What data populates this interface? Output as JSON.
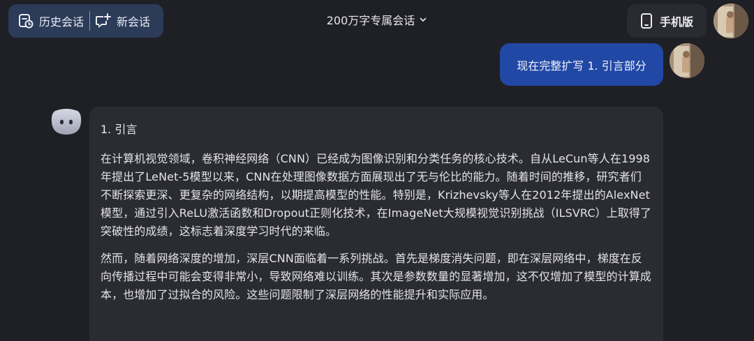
{
  "header": {
    "history_label": "历史会话",
    "new_chat_label": "新会话",
    "title": "200万字专属会话",
    "mobile_label": "手机版"
  },
  "icons": {
    "history": "history-clock-icon",
    "new_chat": "new-chat-icon",
    "dropdown": "chevron-down-icon",
    "mobile": "phone-icon",
    "bot": "bot-avatar-icon"
  },
  "colors": {
    "background": "#1f2025",
    "left_pill": "#2c3b58",
    "user_bubble": "#2248a6",
    "bot_card": "#2b2c33"
  },
  "messages": {
    "user_text": "现在完整扩写 1. 引言部分",
    "bot_heading": "1. 引言",
    "bot_paragraphs": [
      "在计算机视觉领域，卷积神经网络（CNN）已经成为图像识别和分类任务的核心技术。自从LeCun等人在1998年提出了LeNet-5模型以来，CNN在处理图像数据方面展现出了无与伦比的能力。随着时间的推移，研究者们不断探索更深、更复杂的网络结构，以期提高模型的性能。特别是，Krizhevsky等人在2012年提出的AlexNet模型，通过引入ReLU激活函数和Dropout正则化技术，在ImageNet大规模视觉识别挑战（ILSVRC）上取得了突破性的成绩，这标志着深度学习时代的来临。",
      "然而，随着网络深度的增加，深层CNN面临着一系列挑战。首先是梯度消失问题，即在深层网络中，梯度在反向传播过程中可能会变得非常小，导致网络难以训练。其次是参数数量的显著增加，这不仅增加了模型的计算成本，也增加了过拟合的风险。这些问题限制了深层网络的性能提升和实际应用。"
    ]
  }
}
